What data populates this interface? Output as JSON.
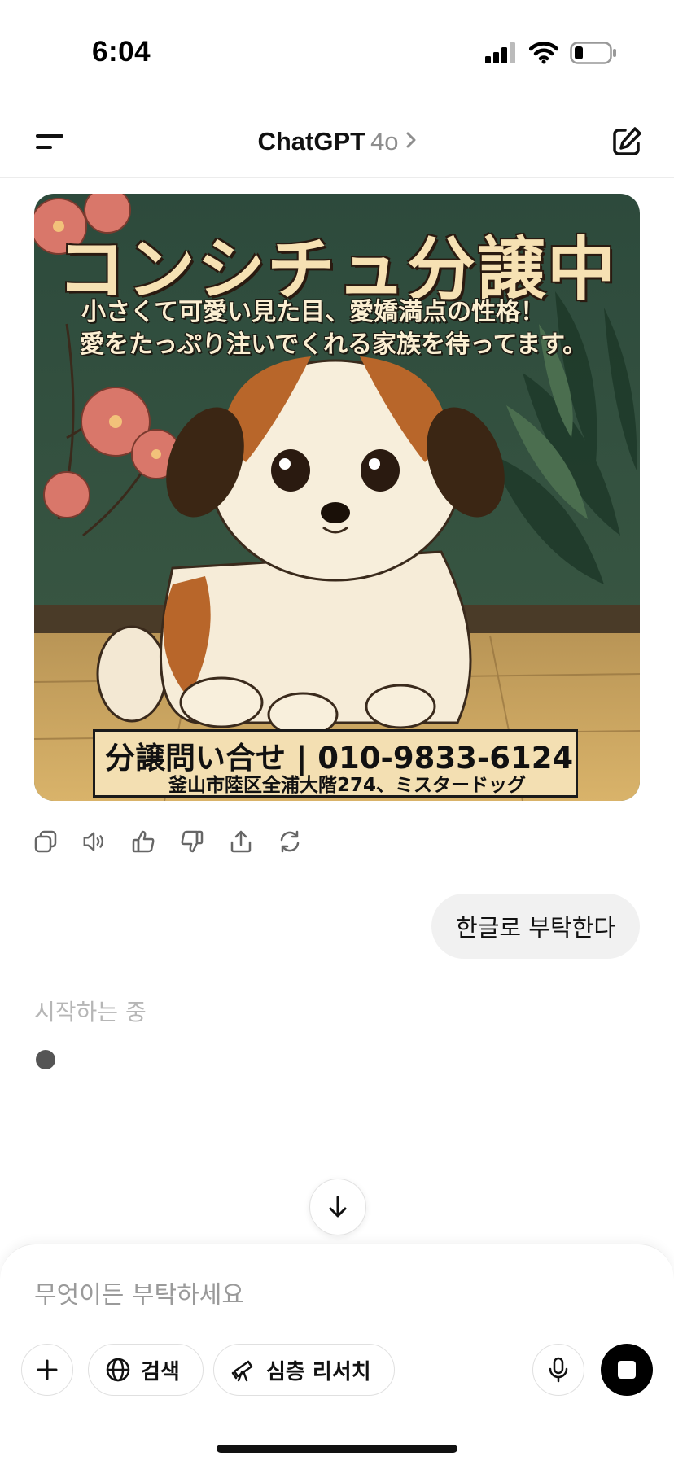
{
  "status_bar": {
    "time": "6:04"
  },
  "header": {
    "app_name": "ChatGPT",
    "model": "4o"
  },
  "poster": {
    "title": "コンシチュ分譲中",
    "subtitle_line1": "小さくて可愛い見た目、愛嬌満点の性格！",
    "subtitle_line2": "愛をたっぷり注いでくれる家族を待ってます。",
    "contact_line1": "分譲問い合せ | 010-9833-6124",
    "contact_line2": "釜山市陸区全浦大階274、ミスタードッグ"
  },
  "message_actions": [
    "copy-icon",
    "speaker-icon",
    "thumbs-up-icon",
    "thumbs-down-icon",
    "share-icon",
    "regenerate-icon"
  ],
  "conversation": {
    "user_message": "한글로 부탁한다",
    "assistant_status": "시작하는 중"
  },
  "composer": {
    "placeholder": "무엇이든 부탁하세요",
    "search_label": "검색",
    "deep_research_label": "심층 리서치"
  },
  "colors": {
    "accent": "#000000",
    "bubble": "#f1f1f1",
    "muted_text": "#9a9a9a"
  }
}
